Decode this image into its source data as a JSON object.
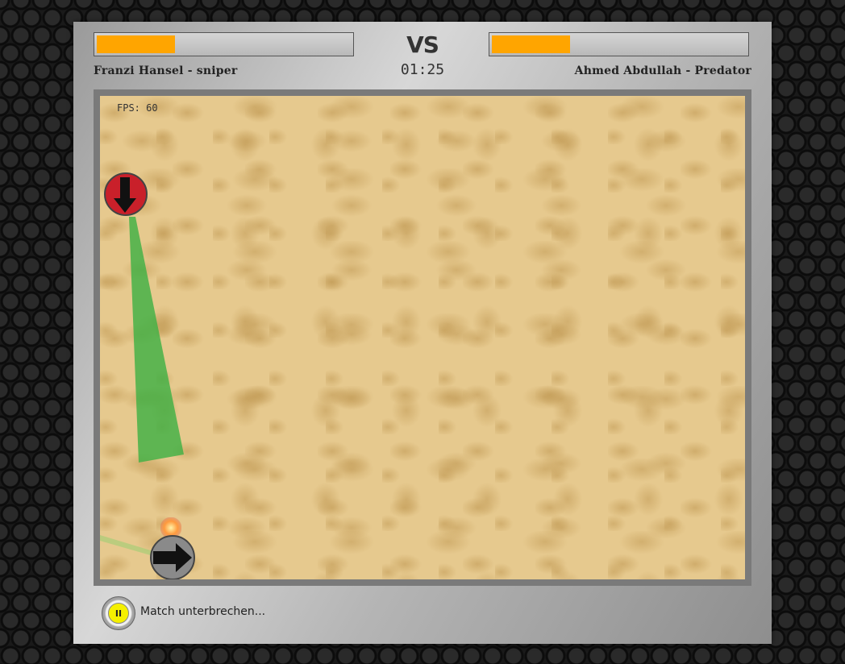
{
  "players": {
    "left": {
      "name": "Franzi Hansel - sniper",
      "health_fraction": 0.3,
      "color": "#ffa500"
    },
    "right": {
      "name": "Ahmed Abdullah - Predator",
      "health_fraction": 0.3,
      "color": "#ffa500"
    }
  },
  "header": {
    "vs_label": "VS",
    "timer": "01:25"
  },
  "arena": {
    "fps_label": "FPS: 60"
  },
  "footer": {
    "pause_icon": "pause-icon",
    "pause_glyph": "II",
    "pause_label": "Match unterbrechen..."
  },
  "colors": {
    "red_unit": "#c9202a",
    "grey_unit": "#8a8a8a",
    "beam": "#3cb043",
    "sand": "#e6c98e"
  }
}
